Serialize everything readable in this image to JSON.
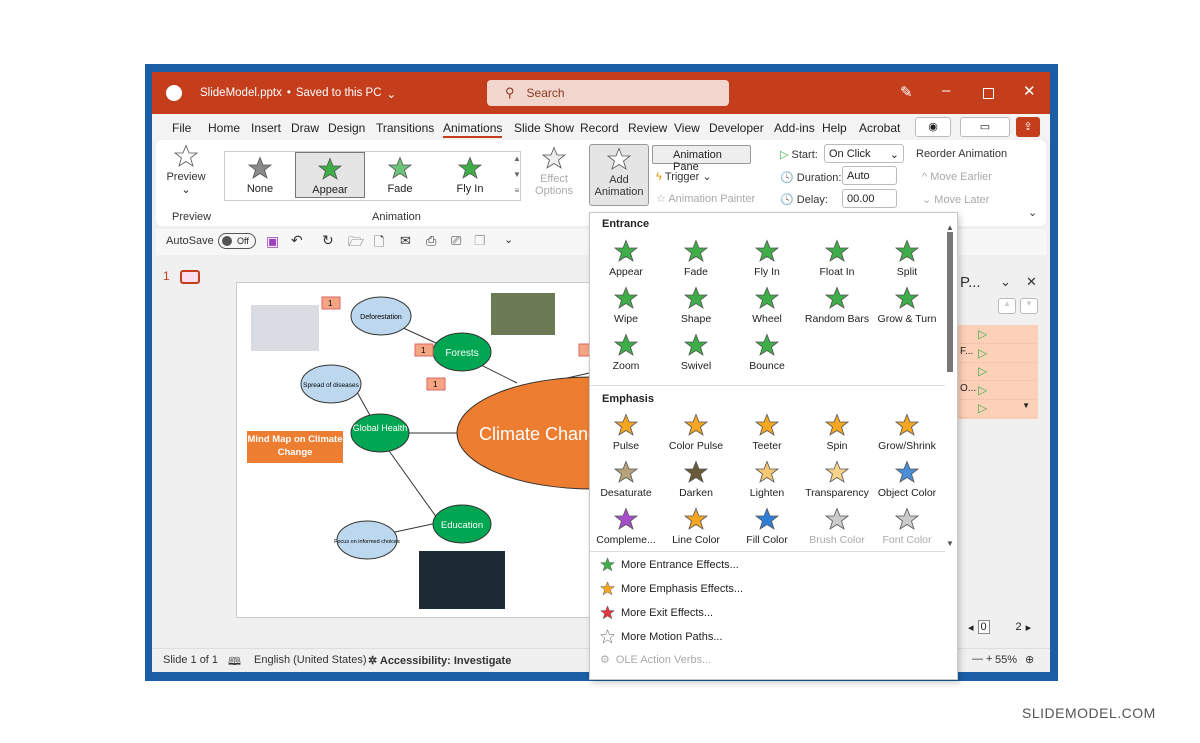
{
  "titlebar": {
    "filename": "SlideModel.pptx",
    "sep": "•",
    "status": "Saved to this PC",
    "search_placeholder": "Search"
  },
  "menu": {
    "tabs": [
      "File",
      "Home",
      "Insert",
      "Draw",
      "Design",
      "Transitions",
      "Animations",
      "Slide Show",
      "Record",
      "Review",
      "View",
      "Developer",
      "Add-ins",
      "Help",
      "Acrobat"
    ],
    "active": "Animations"
  },
  "ribbon": {
    "preview": {
      "label": "Preview",
      "group": "Preview"
    },
    "gallery": [
      {
        "label": "None",
        "color": "#8a8a8a"
      },
      {
        "label": "Appear",
        "color": "#3fae49"
      },
      {
        "label": "Fade",
        "color": "#6cc47a"
      },
      {
        "label": "Fly In",
        "color": "#3fae49"
      }
    ],
    "animation_group": "Animation",
    "effect_options": [
      "Effect",
      "Options"
    ],
    "add_animation": [
      "Add",
      "Animation"
    ],
    "animation_pane": "Animation Pane",
    "trigger": "Trigger",
    "animation_painter": "Animation Painter",
    "start_label": "Start:",
    "start_value": "On Click",
    "duration_label": "Duration:",
    "duration_value": "Auto",
    "delay_label": "Delay:",
    "delay_value": "00.00",
    "reorder": "Reorder Animation",
    "move_earlier": "Move Earlier",
    "move_later": "Move Later"
  },
  "qat": {
    "autosave": "AutoSave",
    "toggle": "Off"
  },
  "thumbs": {
    "number": "1"
  },
  "slide": {
    "center": "Climate Change",
    "title_box": "Mind Map on Climate Change",
    "nodes": {
      "forests": "Forests",
      "global_health": "Global Health",
      "education": "Education",
      "deforestation": "Deforestation",
      "spread": "Spread of diseases",
      "focus": "Focus on informed choices"
    },
    "tag": "1",
    "colors": {
      "center": "#ed7d31",
      "green": "#00a651",
      "blue": "#bdd7ee"
    }
  },
  "dropdown": {
    "entrance_header": "Entrance",
    "entrance": [
      "Appear",
      "Fade",
      "Fly In",
      "Float In",
      "Split",
      "Wipe",
      "Shape",
      "Wheel",
      "Random Bars",
      "Grow & Turn",
      "Zoom",
      "Swivel",
      "Bounce"
    ],
    "emphasis_header": "Emphasis",
    "emphasis": [
      {
        "label": "Pulse",
        "color": "#f5a623"
      },
      {
        "label": "Color Pulse",
        "color": "#f5a623"
      },
      {
        "label": "Teeter",
        "color": "#f5a623"
      },
      {
        "label": "Spin",
        "color": "#f5a623"
      },
      {
        "label": "Grow/Shrink",
        "color": "#f5a623"
      },
      {
        "label": "Desaturate",
        "color": "#b7a27a"
      },
      {
        "label": "Darken",
        "color": "#6b5a3a"
      },
      {
        "label": "Lighten",
        "color": "#f7c873"
      },
      {
        "label": "Transparency",
        "color": "#fad48c"
      },
      {
        "label": "Object Color",
        "color": "#4a8fd8"
      },
      {
        "label": "Compleme...",
        "color": "#a64ec9"
      },
      {
        "label": "Line Color",
        "color": "#f5a623"
      },
      {
        "label": "Fill Color",
        "color": "#2f7ed8"
      },
      {
        "label": "Brush Color",
        "color": "#cccccc",
        "disabled": true
      },
      {
        "label": "Font Color",
        "color": "#cccccc",
        "disabled": true
      }
    ],
    "menu": [
      {
        "label": "More Entrance Effects...",
        "color": "#3fae49"
      },
      {
        "label": "More Emphasis Effects...",
        "color": "#f5a623"
      },
      {
        "label": "More Exit Effects...",
        "color": "#e0383e"
      },
      {
        "label": "More Motion Paths...",
        "color": "#ffffff"
      },
      {
        "label": "OLE Action Verbs...",
        "disabled": true
      }
    ]
  },
  "pane": {
    "title": "P...",
    "items": [
      "",
      "F...",
      "",
      "O...",
      ""
    ],
    "timeline_start": "0",
    "timeline_end": "2"
  },
  "status": {
    "slide": "Slide 1 of 1",
    "language": "English (United States)",
    "accessibility": "Accessibility: Investigate",
    "zoom": "55%"
  },
  "watermark": "SLIDEMODEL.COM"
}
